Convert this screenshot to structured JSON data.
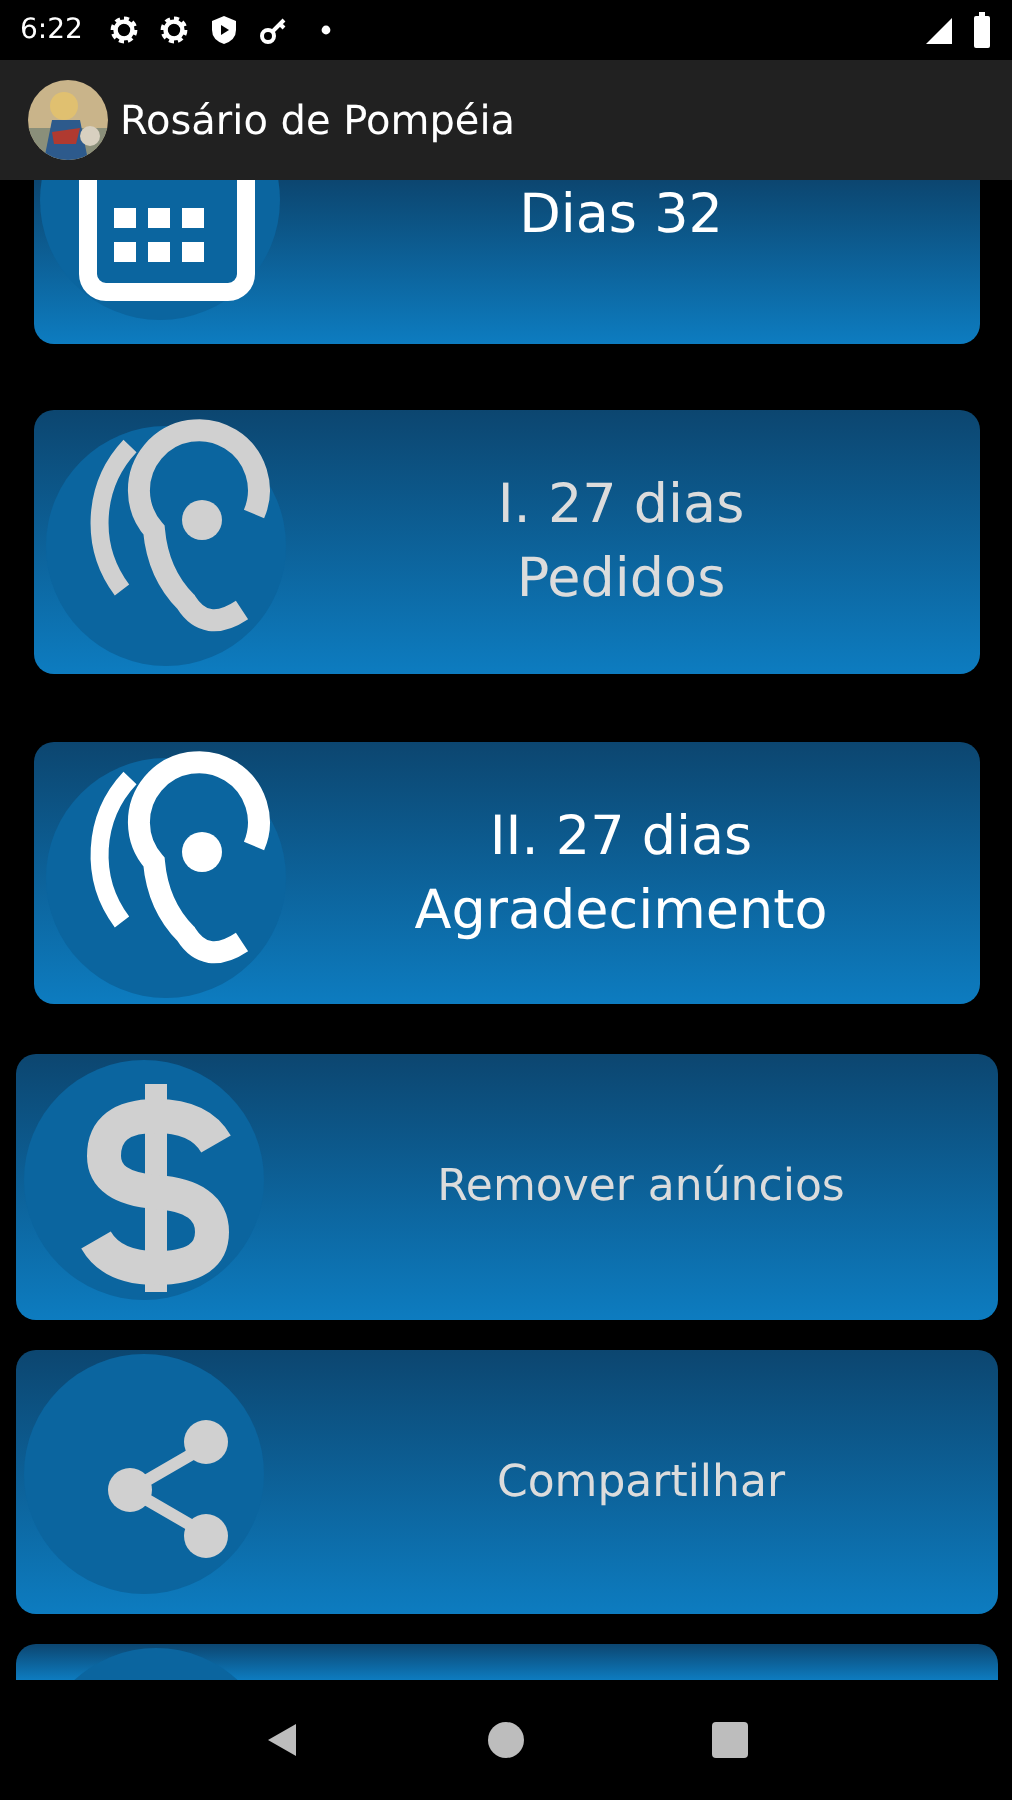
{
  "status_bar": {
    "time": "6:22"
  },
  "app_bar": {
    "title": "Rosário de Pompéia"
  },
  "cards": [
    {
      "kind": "cut_top",
      "lines": [
        "Dias 32"
      ],
      "highlighted": true
    },
    {
      "kind": "full",
      "lines": [
        "I. 27 dias",
        "Pedidos"
      ],
      "highlighted": false
    },
    {
      "kind": "full",
      "lines": [
        "II. 27 dias",
        "Agradecimento"
      ],
      "highlighted": true
    },
    {
      "kind": "full",
      "lines": [
        "Remover anúncios"
      ],
      "highlighted": false
    },
    {
      "kind": "full",
      "lines": [
        "Compartilhar"
      ],
      "highlighted": false
    },
    {
      "kind": "cut_bottom"
    }
  ]
}
